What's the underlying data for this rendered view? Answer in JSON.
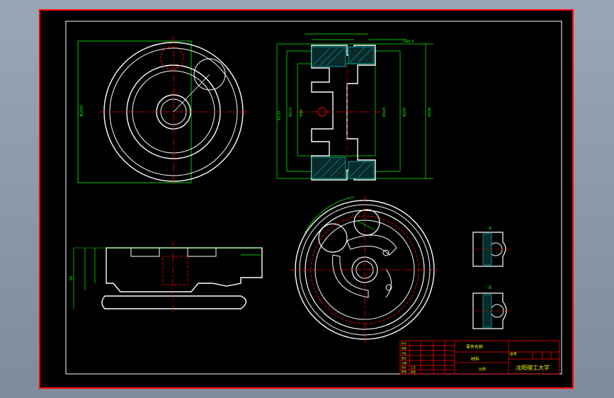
{
  "colors": {
    "app_background": "#8a96a6",
    "sheet": "#000000",
    "border": "#ff0000",
    "outline": "#ffffff",
    "dimension": "#00ff00",
    "hidden": "#ff0000",
    "hatch": "#00ffff",
    "text_title": "#ffff00"
  },
  "views": {
    "section_a_label": "A",
    "section_b_label": "B"
  },
  "dims": {
    "top_left_dia": "Φ200",
    "front_d1": "Φ170",
    "front_d2": "Φ110",
    "front_d3": "Φ94",
    "front_r1": "Φ120",
    "front_r2": "Φ150",
    "front_r3": "Φ190",
    "rough": "Ra6.3",
    "side_h": "50"
  },
  "title_block": {
    "part_name": "零件名称",
    "material": "材料",
    "scale": "比例",
    "school": "沈阳理工大学",
    "drawing_no": "序号",
    "rev_labels": [
      "标记",
      "处数",
      "分区",
      "签名",
      "日期",
      "设计",
      "审核",
      "工艺",
      "批准"
    ]
  }
}
